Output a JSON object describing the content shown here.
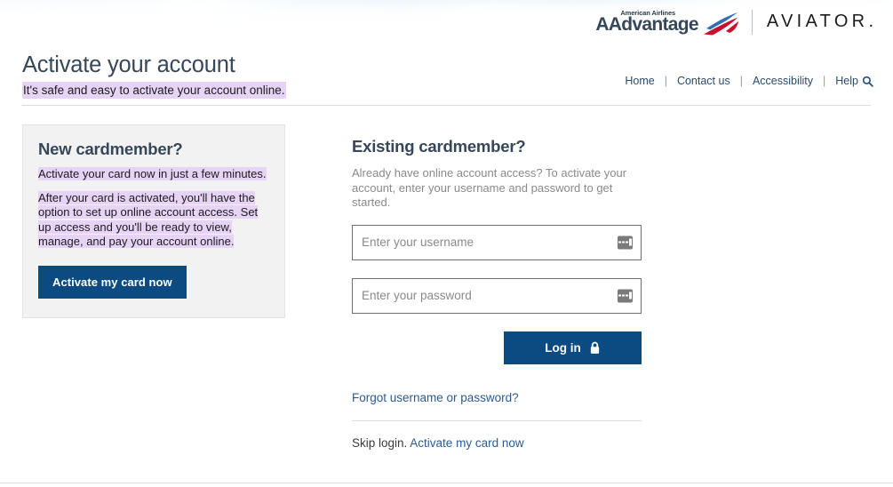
{
  "banner": {
    "logos": {
      "aadvantage_small": "American Airlines",
      "aadvantage_main": "AAdvantage",
      "aviator": "AVIATOR",
      "aviator_dot": "."
    }
  },
  "header": {
    "title": "Activate your account",
    "subtitle": "It's safe and easy to activate your account online.",
    "nav": {
      "home": "Home",
      "contact": "Contact us",
      "accessibility": "Accessibility",
      "help": "Help",
      "separator": "|",
      "search_icon": "search-icon"
    }
  },
  "new_cardmember": {
    "heading": "New cardmember?",
    "paragraph1": "Activate your card now in just a few minutes.",
    "paragraph2": "After your card is activated, you'll have the option to set up online account access. Set up access and you'll be ready to view, manage, and pay your account online.",
    "button_label": "Activate my card now"
  },
  "existing_cardmember": {
    "heading": "Existing cardmember?",
    "lead": "Already have online account access? To activate your account, enter your username and password to get started.",
    "username": {
      "value": "",
      "placeholder": "Enter your username",
      "autofill_icon": "autofill-icon"
    },
    "password": {
      "value": "",
      "placeholder": "Enter your password",
      "autofill_icon": "autofill-icon"
    },
    "login_button": {
      "label": "Log in",
      "icon": "lock-icon"
    },
    "forgot_link": "Forgot username or password?",
    "skip_prefix": "Skip login. ",
    "skip_link": "Activate my card now"
  },
  "colors": {
    "brand_navy": "#0b4b82",
    "link_blue": "#2c5c8f",
    "heading_slate": "#36475a",
    "highlight_lavender": "#e7d3f5",
    "card_bg": "#f2f2f2",
    "sky_blue": "#8fd0ee"
  }
}
